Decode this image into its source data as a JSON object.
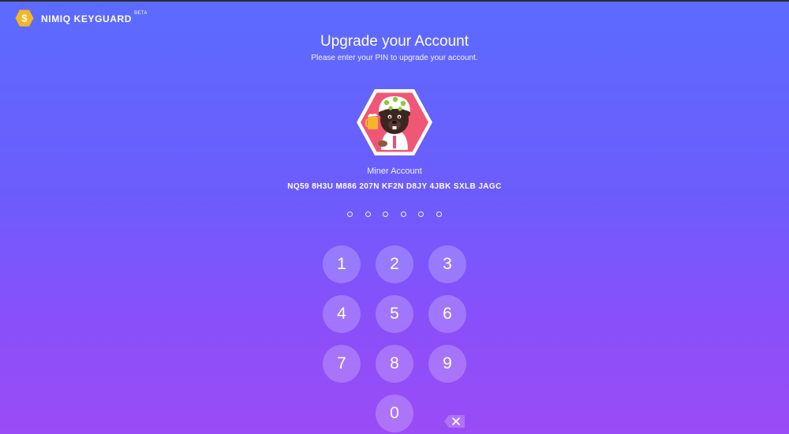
{
  "brand": {
    "name": "NIMIQ KEYGUARD",
    "beta": "BETA",
    "logo_icon": "hexagon-nimiq-logo-icon",
    "logo_color": "#f5b623"
  },
  "header": {
    "title": "Upgrade your Account",
    "subtitle": "Please enter your PIN to upgrade your account."
  },
  "account": {
    "avatar_icon": "beaver-identicon-icon",
    "avatar_bg": "#f05777",
    "name": "Miner Account",
    "address": "NQ59 8H3U M886 207N KF2N D8JY 4JBK SXLB JAGC"
  },
  "pin": {
    "length": 6,
    "entered": 0
  },
  "keypad": {
    "keys": [
      "1",
      "2",
      "3",
      "4",
      "5",
      "6",
      "7",
      "8",
      "9",
      "0"
    ],
    "backspace_icon": "backspace-icon"
  },
  "colors": {
    "background_top": "#5b6bff",
    "background_bottom": "#9a4cf6"
  }
}
